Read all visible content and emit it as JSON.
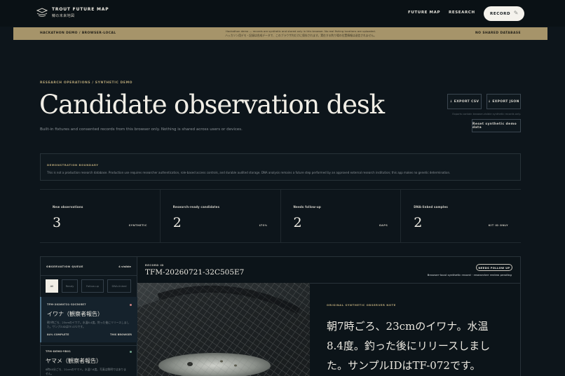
{
  "header": {
    "brand_title": "TROUT FUTURE MAP",
    "brand_subtitle": "鱒の未来地図",
    "nav": [
      "FUTURE MAP",
      "RESEARCH"
    ],
    "record_label": "RECORD"
  },
  "banner": {
    "left": "HACKATHON DEMO / BROWSER-LOCAL",
    "center_en": "Hackathon demo — records are synthetic and stored only in this browser. No real fishing locations are uploaded.",
    "center_ja": "ハッカソン用デモ・記録は合成データで、このブラウザ内だけに保存されます。実在する釣り場の位置情報は送信されません。",
    "right": "NO SHARED DATABASE"
  },
  "page": {
    "eyebrow": "RESEARCH OPERATIONS / SYNTHETIC DEMO",
    "title": "Candidate observation desk",
    "subtitle": "Built-in fixtures and consented records from this browser only. Nothing is shared across users or devices.",
    "export_csv": "↓ EXPORT CSV",
    "export_json": "↓ EXPORT JSON",
    "export_note": "Exports contain browser-visible synthetic records only.",
    "reset_label": "Reset synthetic demo data"
  },
  "boundary": {
    "title": "DEMONSTRATION BOUNDARY",
    "text": "This is not a production research database. Production use requires researcher authentication, role-based access controls, and durable audited storage. DNA analysis remains a future step performed by an approved external research institution; this app makes no genetic determination."
  },
  "stats": [
    {
      "label": "New observations",
      "value": "3",
      "tag": "SYNTHETIC"
    },
    {
      "label": "Research-ready candidates",
      "value": "2",
      "tag": "LTS%"
    },
    {
      "label": "Needs follow-up",
      "value": "2",
      "tag": "GAPS"
    },
    {
      "label": "DNA-linked samples",
      "value": "2",
      "tag": "KIT ID ONLY"
    }
  ],
  "queue": {
    "title": "OBSERVATION QUEUE",
    "count": "4 visible",
    "filters": [
      "All",
      "Ready",
      "Follow-up",
      "DNA-linked"
    ],
    "items": [
      {
        "id": "TFM-20260721-32C505E7",
        "name": "イワナ（観察者報告）",
        "desc": "朝7時ごろ、23cmのイワナ。水温8.4度。釣った後にリリースしました。サンプルIDはTF-072です。",
        "foot_left": "84% COMPLETE",
        "foot_right": "THIS BROWSER",
        "dot_color": "#c98080"
      },
      {
        "id": "TFM-DEMO-YB01",
        "name": "ヤマメ（観察者報告）",
        "desc": "6時40分ごろ、21cmのヤマメ。水温7.6度。写真は鮮明ではありません。",
        "dot_color": "#6fa08a"
      }
    ]
  },
  "record": {
    "label": "RECORD ID",
    "id": "TFM-20260721-32C505E7",
    "badge": "NEEDS FOLLOW UP",
    "sub": "Browser-local synthetic record · researcher review pending",
    "note_label": "ORIGINAL SYNTHETIC OBSERVER NOTE",
    "note_text": "朝7時ごろ、23cmのイワナ。水温8.4度。釣った後にリリースしました。サンプルIDはTF-072です。"
  }
}
